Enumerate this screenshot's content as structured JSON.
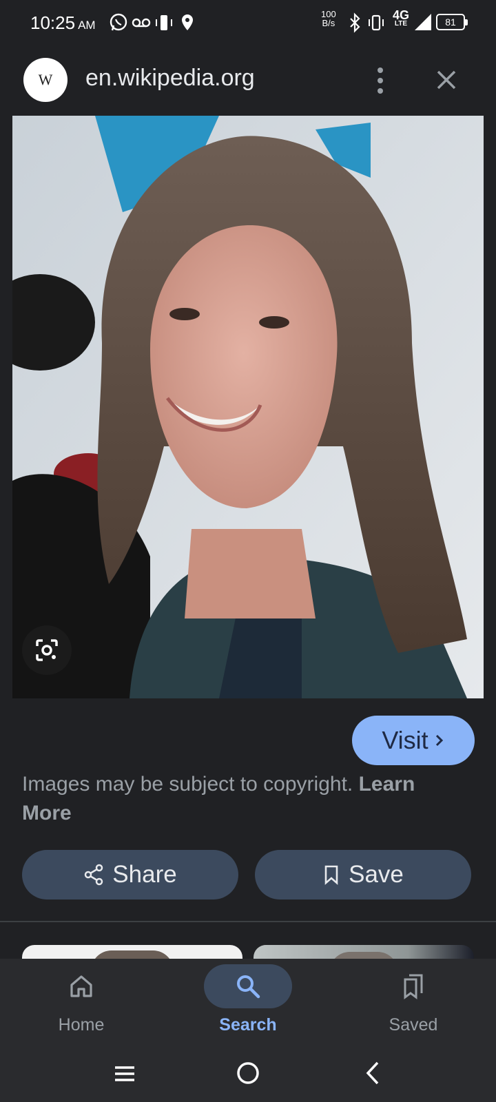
{
  "status_bar": {
    "time": "10:25",
    "ampm": "AM",
    "network_speed_top": "100",
    "network_speed_bottom": "B/s",
    "network_type": "4G",
    "network_sub": "LTE",
    "battery": "81"
  },
  "top_bar": {
    "favicon_letter": "W",
    "domain": "en.wikipedia.org"
  },
  "actions": {
    "visit_label": "Visit",
    "copyright_text": "Images may be subject to copyright. ",
    "learn_more": "Learn More",
    "share_label": "Share",
    "save_label": "Save"
  },
  "bottom_nav": {
    "items": [
      {
        "label": "Home"
      },
      {
        "label": "Search"
      },
      {
        "label": "Saved"
      }
    ]
  },
  "colors": {
    "accent": "#8ab4f8",
    "background": "#202124",
    "button_bg": "#3c4a5e"
  }
}
